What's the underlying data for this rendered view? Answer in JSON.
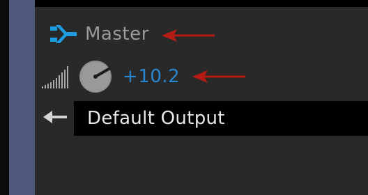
{
  "master": {
    "label": "Master",
    "icon": "bus-output-icon",
    "icon_color": "#1f9be0",
    "label_color": "#9a9a9a"
  },
  "volume": {
    "value": "+10.2",
    "value_color": "#2a86cf",
    "meter_icon": "signal-strength-icon",
    "knob_icon": "volume-knob-icon"
  },
  "output": {
    "label": "Default Output",
    "back_icon": "back-arrow-icon"
  },
  "annotations": {
    "arrow_color": "#b71c14"
  },
  "colors": {
    "panel": "#292929",
    "sidebar": "#4e587a",
    "field": "#000000"
  }
}
